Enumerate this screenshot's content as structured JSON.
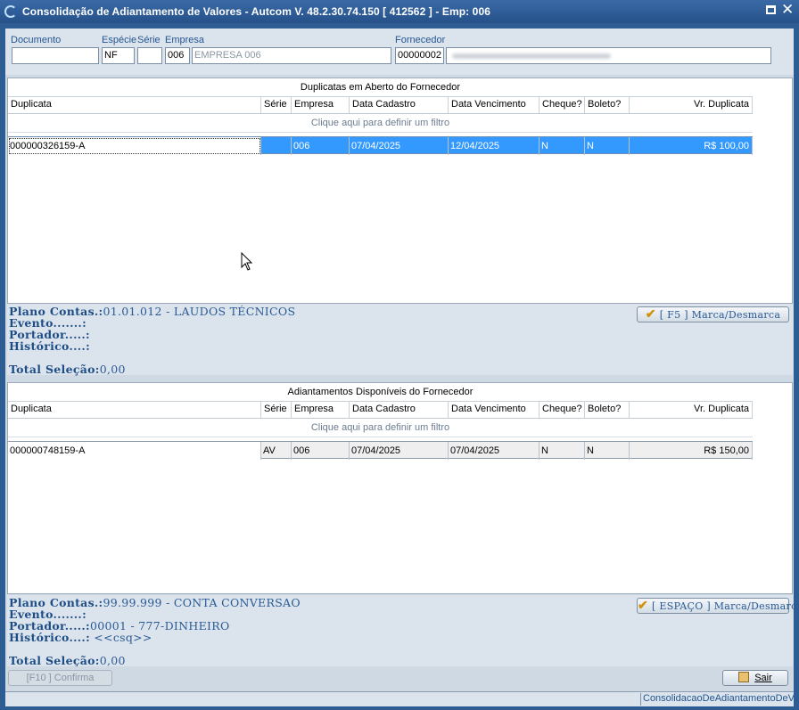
{
  "window": {
    "title": "Consolidação de Adiantamento de Valores   -   Autcom V. 48.2.30.74.150 [ 412562 ] - Emp: 006",
    "max_icon": "maximize-icon",
    "close_icon": "close-icon",
    "close_glyph": "✕"
  },
  "header": {
    "documento_label": "Documento",
    "documento_value": "",
    "especie_label": "Espécie",
    "especie_value": "NF",
    "serie_label": "Série",
    "serie_value": "",
    "empresa_label": "Empresa",
    "empresa_code": "006",
    "empresa_name": "EMPRESA 006",
    "fornecedor_label": "Fornecedor",
    "fornecedor_code": "00000002"
  },
  "columns": [
    "Duplicata",
    "Série",
    "Empresa",
    "Data Cadastro",
    "Data Vencimento",
    "Cheque?",
    "Boleto?",
    "Vr. Duplicata"
  ],
  "grid1": {
    "title": "Duplicatas em Aberto do Fornecedor",
    "filter_text": "Clique aqui para definir um filtro",
    "rows": [
      {
        "duplicata": "000000326159-A",
        "serie": "",
        "empresa": "006",
        "data_cadastro": "07/04/2025",
        "data_vencimento": "12/04/2025",
        "cheque": "N",
        "boleto": "N",
        "valor": "R$ 100,00"
      }
    ]
  },
  "info1": {
    "plano_label": "Plano Contas.:",
    "plano_value": "01.01.012 - LAUDOS TÉCNICOS",
    "evento_label": "Evento.......:",
    "evento_value": "",
    "portador_label": "Portador.....:",
    "portador_value": "",
    "historico_label": "Histórico....:",
    "historico_value": "",
    "total_label": "Total Seleção:",
    "total_value": "0,00",
    "button_label": "[ F5 ] Marca/Desmarca",
    "button_icon": "check-icon"
  },
  "grid2": {
    "title": "Adiantamentos Disponíveis do Fornecedor",
    "filter_text": "Clique aqui para definir um filtro",
    "rows": [
      {
        "duplicata": "000000748159-A",
        "serie": "AV",
        "empresa": "006",
        "data_cadastro": "07/04/2025",
        "data_vencimento": "07/04/2025",
        "cheque": "N",
        "boleto": "N",
        "valor": "R$ 150,00"
      }
    ]
  },
  "info2": {
    "plano_label": "Plano Contas.:",
    "plano_value": "99.99.999 - CONTA CONVERSAO",
    "evento_label": "Evento.......:",
    "evento_value": "",
    "portador_label": "Portador.....:",
    "portador_value": "00001 - 777-DINHEIRO",
    "historico_label": "Histórico....:",
    "historico_value": " <<csq>>",
    "total_label": "Total Seleção:",
    "total_value": "0,00",
    "button_label": "[ ESPAÇO ] Marca/Desmarca",
    "button_icon": "check-icon"
  },
  "footer": {
    "confirm_label": "[F10 ] Confirma",
    "exit_label": "Sair",
    "exit_icon": "exit-door-icon"
  },
  "status": {
    "form_name": "ConsolidacaoDeAdiantamentoDeValores"
  },
  "colors": {
    "selection": "#3399ff",
    "titlebar": "#2e5d93",
    "label_blue": "#24558f"
  }
}
